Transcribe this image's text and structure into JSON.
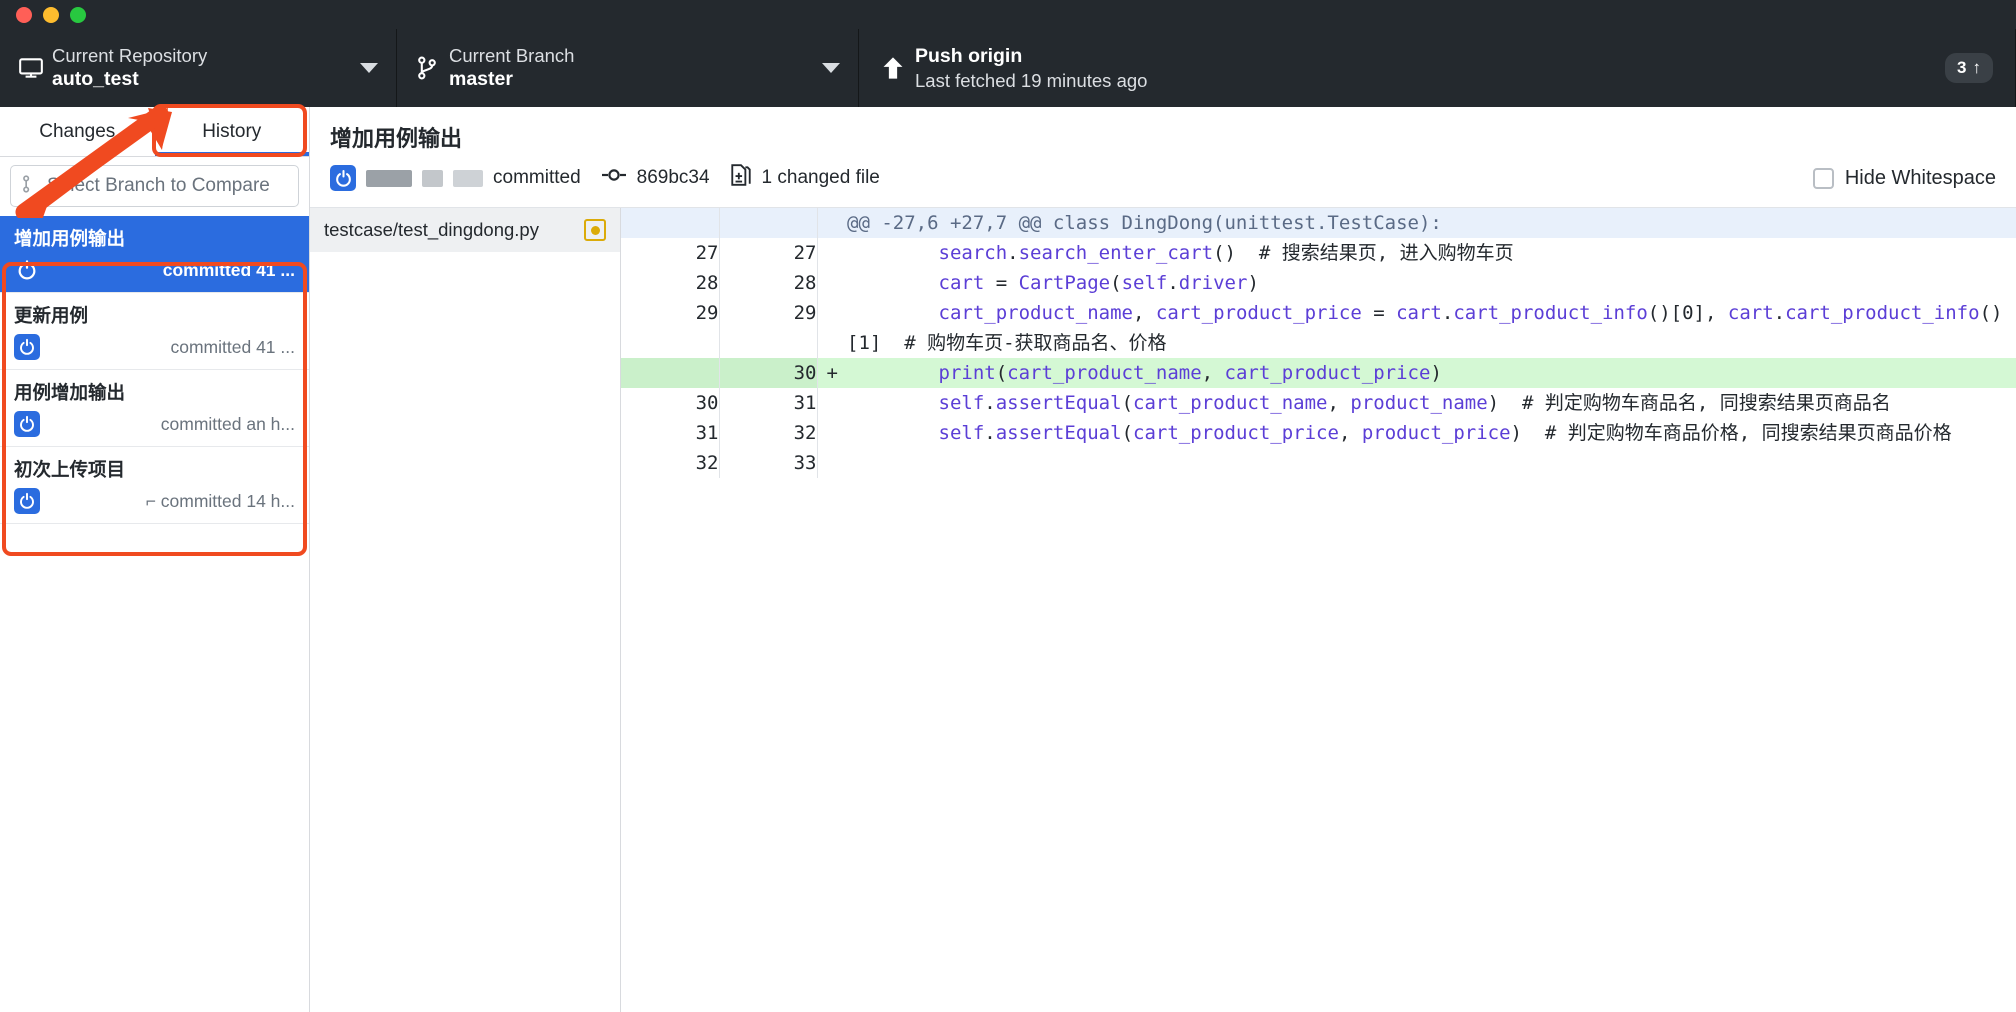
{
  "window": {
    "traffic_lights": [
      "close",
      "minimize",
      "maximize"
    ]
  },
  "toolbar": {
    "repository": {
      "label": "Current Repository",
      "value": "auto_test",
      "icon": "desktop-icon"
    },
    "branch": {
      "label": "Current Branch",
      "value": "master",
      "icon": "git-branch-icon"
    },
    "push": {
      "label": "Push origin",
      "sublabel": "Last fetched 19 minutes ago",
      "icon": "arrow-up-icon",
      "ahead_count": "3",
      "ahead_arrow": "↑"
    }
  },
  "sidebar": {
    "tabs": [
      {
        "label": "Changes",
        "active": false
      },
      {
        "label": "History",
        "active": true
      }
    ],
    "compare": {
      "placeholder": "Select Branch to Compare",
      "icon": "git-compare-icon"
    },
    "commits": [
      {
        "title": "增加用例输出",
        "when": "committed 41 ...",
        "selected": true
      },
      {
        "title": "更新用例",
        "when": "committed 41 ...",
        "selected": false
      },
      {
        "title": "用例增加输出",
        "when": "committed an h...",
        "selected": false
      },
      {
        "title": "初次上传项目",
        "when": "⌐ committed 14 h...",
        "selected": false
      }
    ]
  },
  "commit_detail": {
    "summary": "增加用例输出",
    "author_redacted": true,
    "committed_label": "committed",
    "sha": "869bc34",
    "changed_files": "1 changed file",
    "hide_whitespace_label": "Hide Whitespace",
    "hide_whitespace_checked": false
  },
  "files": [
    {
      "name": "testcase/test_dingdong.py",
      "status": "modified"
    }
  ],
  "diff": {
    "hunk_header": "@@ -27,6 +27,7 @@ class DingDong(unittest.TestCase):",
    "rows": [
      {
        "type": "hunk",
        "old": "",
        "new": "",
        "marker": "",
        "code": "@@ -27,6 +27,7 @@ class DingDong(unittest.TestCase):"
      },
      {
        "type": "ctx",
        "old": "27",
        "new": "27",
        "marker": "",
        "code": "        search.search_enter_cart()  # 搜索结果页, 进入购物车页"
      },
      {
        "type": "ctx",
        "old": "28",
        "new": "28",
        "marker": "",
        "code": "        cart = CartPage(self.driver)"
      },
      {
        "type": "ctx",
        "old": "29",
        "new": "29",
        "marker": "",
        "code": "        cart_product_name, cart_product_price = cart.cart_product_info()[0], cart.cart_product_info()[1]  # 购物车页-获取商品名、价格"
      },
      {
        "type": "add",
        "old": "",
        "new": "30",
        "marker": "+",
        "code": "        print(cart_product_name, cart_product_price)"
      },
      {
        "type": "ctx",
        "old": "30",
        "new": "31",
        "marker": "",
        "code": "        self.assertEqual(cart_product_name, product_name)  # 判定购物车商品名, 同搜索结果页商品名"
      },
      {
        "type": "ctx",
        "old": "31",
        "new": "32",
        "marker": "",
        "code": "        self.assertEqual(cart_product_price, product_price)  # 判定购物车商品价格, 同搜索结果页商品价格"
      },
      {
        "type": "ctx",
        "old": "32",
        "new": "33",
        "marker": "",
        "code": ""
      }
    ]
  },
  "colors": {
    "toolbar_bg": "#24292e",
    "accent_blue": "#2b6cdf",
    "annotation_orange": "#f04a20",
    "added_green": "#d4f8d4",
    "modified_yellow": "#dbab09"
  },
  "annotations": {
    "history_tab_highlight": true,
    "commit_list_highlight": true,
    "arrow_to_history_tab": true
  }
}
